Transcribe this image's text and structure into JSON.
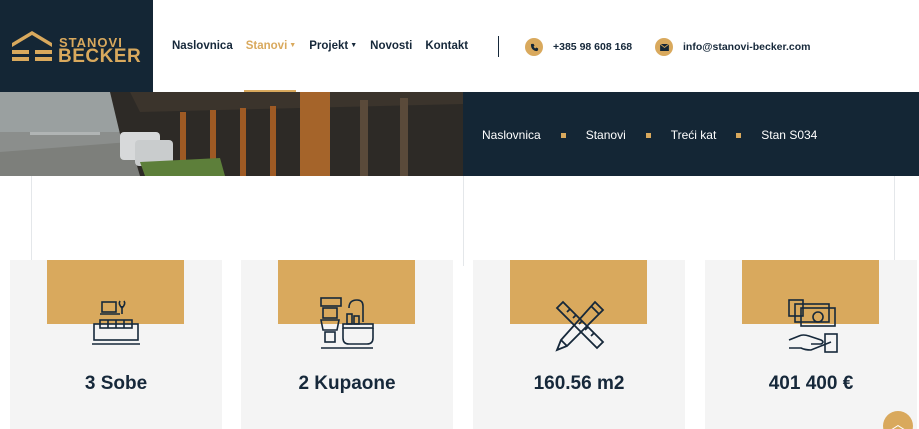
{
  "brand": {
    "top": "STANOVI",
    "bottom": "BECKER"
  },
  "nav": {
    "items": [
      {
        "label": "Naslovnica"
      },
      {
        "label": "Stanovi"
      },
      {
        "label": "Projekt"
      },
      {
        "label": "Novosti"
      },
      {
        "label": "Kontakt"
      }
    ]
  },
  "contact": {
    "phone": "+385 98 608 168",
    "email": "info@stanovi-becker.com"
  },
  "breadcrumb": [
    "Naslovnica",
    "Stanovi",
    "Treći kat",
    "Stan S034"
  ],
  "features": [
    {
      "icon": "sofa-icon",
      "value": "3 Sobe"
    },
    {
      "icon": "bathroom-icon",
      "value": "2 Kupaone"
    },
    {
      "icon": "ruler-pencil-icon",
      "value": "160.56 m2"
    },
    {
      "icon": "money-hand-icon",
      "value": "401 400 €"
    }
  ],
  "colors": {
    "accent": "#d9a95d",
    "navy": "#142635",
    "card": "#f4f4f4"
  }
}
